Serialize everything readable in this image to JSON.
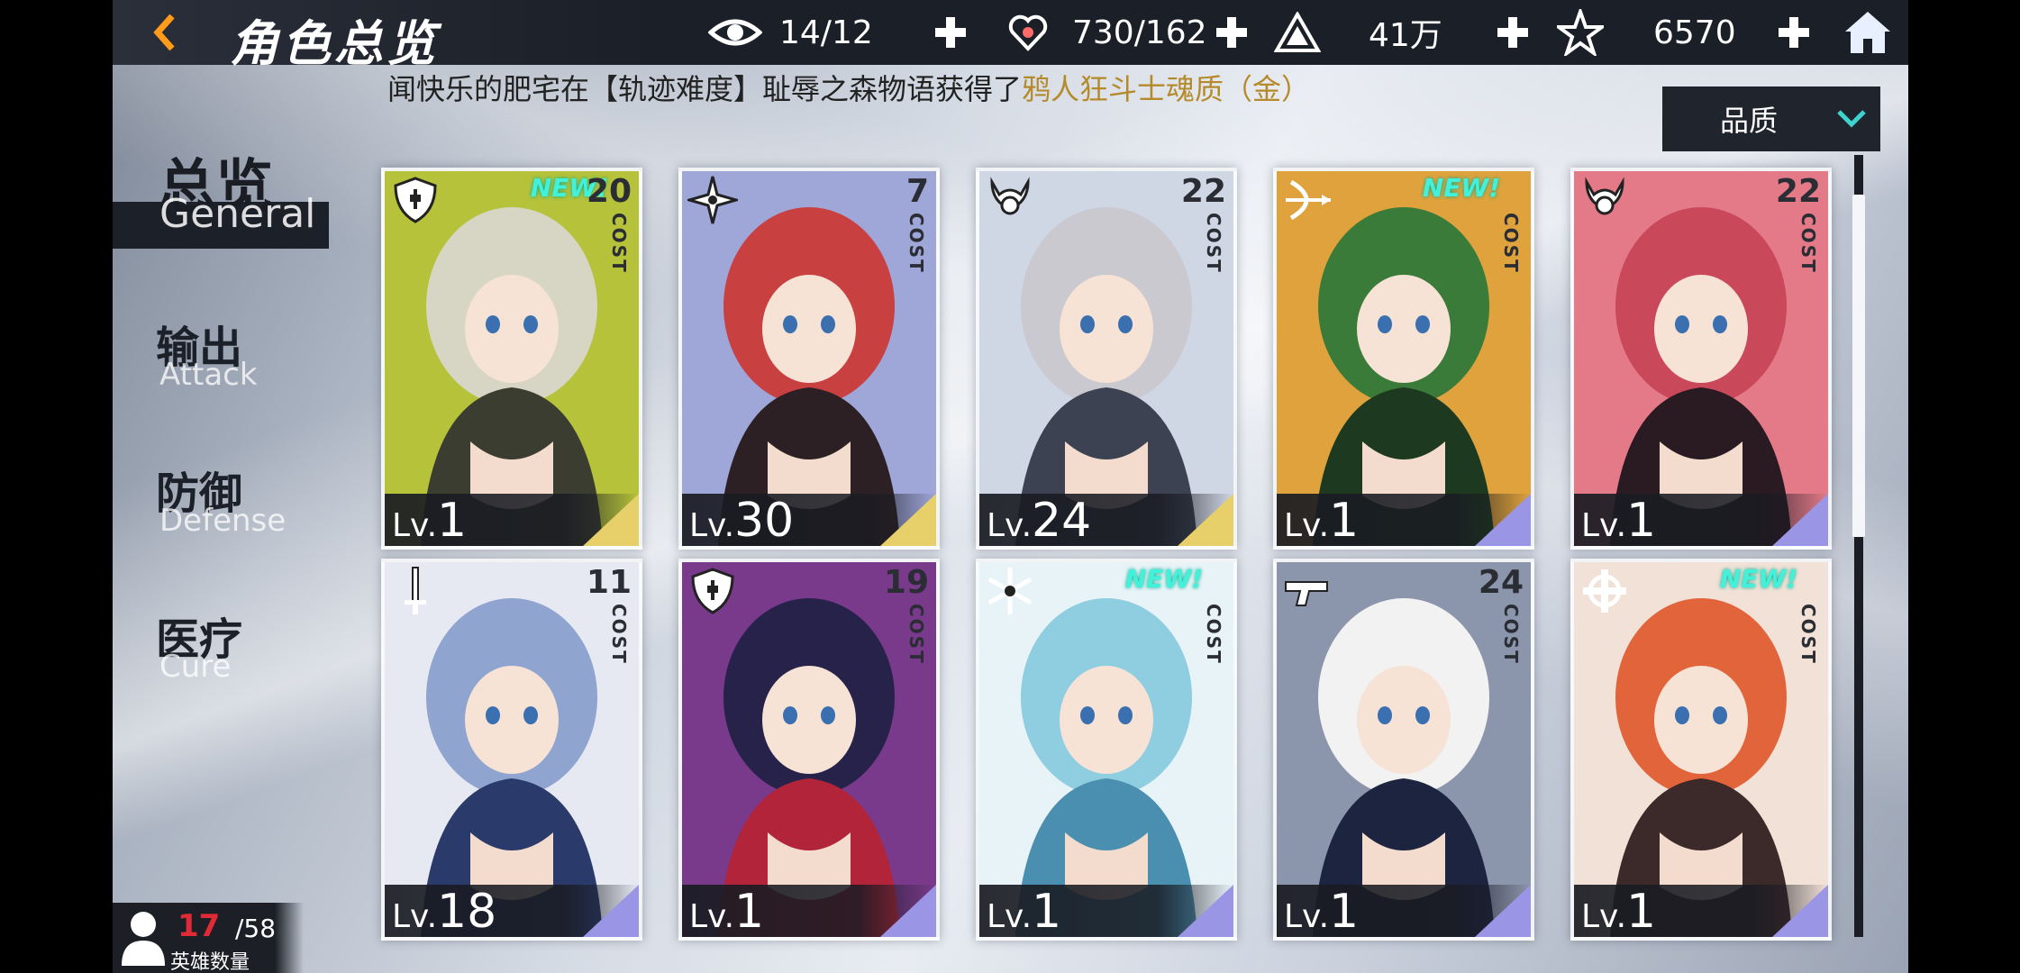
{
  "header": {
    "back_icon": "back-arrow-icon",
    "title": "角色总览",
    "resources": [
      {
        "name": "vision",
        "icon": "eye-icon",
        "value": "14/12"
      },
      {
        "name": "stamina",
        "icon": "heart-icon",
        "value": "730/162"
      },
      {
        "name": "gold",
        "icon": "coin-pyramid-icon",
        "value": "41万"
      },
      {
        "name": "crystal",
        "icon": "star-crystal-icon",
        "value": "6570"
      }
    ],
    "home_icon": "home-icon"
  },
  "broadcast": {
    "prefix": "闻快乐的肥宅在【轨迹难度】耻辱之森物语获得了",
    "reward": "鸦人狂斗士魂质（金）"
  },
  "sort": {
    "label": "品质",
    "icon": "chevron-down-icon"
  },
  "nav": [
    {
      "zh": "总览",
      "en": "General"
    },
    {
      "zh": "输出",
      "en": "Attack"
    },
    {
      "zh": "防御",
      "en": "Defense"
    },
    {
      "zh": "医疗",
      "en": "Cure"
    }
  ],
  "cards": [
    {
      "cost": "20",
      "class": "shield",
      "lv_prefix": "Lv.",
      "lv": "1",
      "new": "NEW!",
      "rarity": "gold"
    },
    {
      "cost": "7",
      "class": "shuriken",
      "lv_prefix": "Lv.",
      "lv": "30",
      "new": "",
      "rarity": "gold"
    },
    {
      "cost": "22",
      "class": "horns",
      "lv_prefix": "Lv.",
      "lv": "24",
      "new": "",
      "rarity": "gold"
    },
    {
      "cost": "",
      "class": "bow",
      "lv_prefix": "Lv.",
      "lv": "1",
      "new": "NEW!",
      "rarity": "purple"
    },
    {
      "cost": "22",
      "class": "horns",
      "lv_prefix": "Lv.",
      "lv": "1",
      "new": "",
      "rarity": "purple"
    },
    {
      "cost": "11",
      "class": "sword",
      "lv_prefix": "Lv.",
      "lv": "18",
      "new": "",
      "rarity": "purple"
    },
    {
      "cost": "19",
      "class": "shield",
      "lv_prefix": "Lv.",
      "lv": "1",
      "new": "",
      "rarity": "purple"
    },
    {
      "cost": "",
      "class": "snowflake",
      "lv_prefix": "Lv.",
      "lv": "1",
      "new": "NEW!",
      "rarity": "purple"
    },
    {
      "cost": "24",
      "class": "gun",
      "lv_prefix": "Lv.",
      "lv": "1",
      "new": "",
      "rarity": "purple"
    },
    {
      "cost": "",
      "class": "cross",
      "lv_prefix": "Lv.",
      "lv": "1",
      "new": "NEW!",
      "rarity": "purple"
    }
  ],
  "cost_label": "COST",
  "hero_count": {
    "current": "17",
    "max": "/58",
    "label": "英雄数量"
  }
}
